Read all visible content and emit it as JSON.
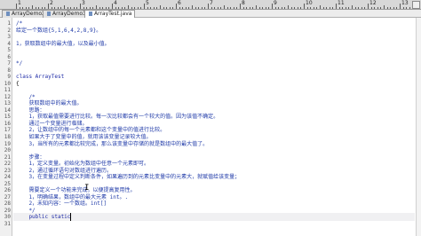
{
  "tabs": [
    {
      "label": "ArrayDemo2.java"
    },
    {
      "label": "ArrayDemo3.java"
    },
    {
      "label": "ArrayTest.java"
    }
  ],
  "ruler": {
    "numbers": [
      "1",
      "2",
      "3",
      "4",
      "5",
      "6",
      "7",
      "8",
      "9",
      "10",
      "11",
      "12",
      "13",
      "14",
      "15",
      "16",
      "17",
      "18",
      "19",
      "20",
      "21",
      "22",
      "23",
      "24",
      "25",
      "26",
      "27",
      "28",
      "29",
      "30"
    ]
  },
  "editor": {
    "lines": [
      {
        "n": "1",
        "text": "/*",
        "cls": "cmt"
      },
      {
        "n": "2",
        "text": "给定一个数组{5,1,6,4,2,8,9}。",
        "cls": "cmt"
      },
      {
        "n": "3",
        "text": "",
        "cls": "cmt"
      },
      {
        "n": "4",
        "text": "1，获取数组中的最大值，以及最小值。",
        "cls": "cmt"
      },
      {
        "n": "5",
        "text": "",
        "cls": "cmt"
      },
      {
        "n": "6",
        "text": "",
        "cls": "cmt"
      },
      {
        "n": "7",
        "text": "*/",
        "cls": "cmt"
      },
      {
        "n": "8",
        "text": "",
        "cls": ""
      },
      {
        "n": "9",
        "text": "class ArrayTest",
        "cls": "kw"
      },
      {
        "n": "10",
        "text": "{",
        "cls": ""
      },
      {
        "n": "11",
        "text": "",
        "cls": ""
      },
      {
        "n": "12",
        "text": "    /*",
        "cls": "cmt"
      },
      {
        "n": "13",
        "text": "    获取数组中的最大值。",
        "cls": "cmt"
      },
      {
        "n": "14",
        "text": "    思路：",
        "cls": "cmt"
      },
      {
        "n": "15",
        "text": "    1，获取最值需要进行比较。每一次比较都会有一个较大的值。因为该值不确定。",
        "cls": "cmt"
      },
      {
        "n": "16",
        "text": "    通过一个变量进行临储。",
        "cls": "cmt"
      },
      {
        "n": "17",
        "text": "    2，让数组中的每一个元素都和这个变量中的值进行比较。",
        "cls": "cmt"
      },
      {
        "n": "18",
        "text": "    如果大于了变量中的值，就用该该变量记录较大值。",
        "cls": "cmt"
      },
      {
        "n": "19",
        "text": "    3，当所有的元素都比较完成，那么该变量中存储的就是数组中的最大值了。",
        "cls": "cmt"
      },
      {
        "n": "20",
        "text": "",
        "cls": "cmt"
      },
      {
        "n": "21",
        "text": "    步骤：",
        "cls": "cmt"
      },
      {
        "n": "22",
        "text": "    1，定义变量。初始化为数组中任意一个元素即可。",
        "cls": "cmt"
      },
      {
        "n": "23",
        "text": "    2，通过循环语句对数组进行遍历。",
        "cls": "cmt"
      },
      {
        "n": "24",
        "text": "    3，在变量过程中定义判断条件，如果遍历到的元素比变量中的元素大，就赋值给该变量；",
        "cls": "cmt"
      },
      {
        "n": "25",
        "text": "",
        "cls": "cmt"
      },
      {
        "n": "26",
        "text": "    需要定义一个功能来完成，以便提高复用性。",
        "cls": "cmt"
      },
      {
        "n": "27",
        "text": "    1，明确结果，数组中的最大元素 int。.",
        "cls": "cmt"
      },
      {
        "n": "28",
        "text": "    2，未知内容：一个数组。int[]",
        "cls": "cmt"
      },
      {
        "n": "29",
        "text": "    */",
        "cls": "cmt"
      },
      {
        "n": "30",
        "text": "    public static",
        "cls": "kw"
      },
      {
        "n": "31",
        "text": "",
        "cls": ""
      }
    ]
  }
}
